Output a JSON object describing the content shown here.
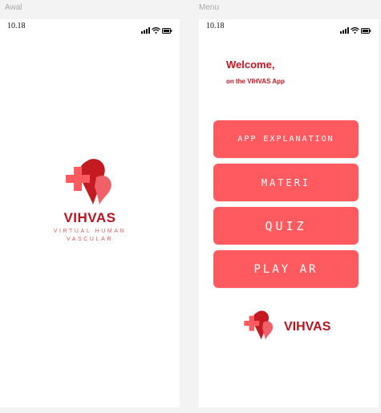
{
  "frames": {
    "splash_label": "Awal",
    "menu_label": "Menu"
  },
  "status_bar": {
    "time": "10.18",
    "icons": [
      "signal-icon",
      "wifi-icon",
      "battery-icon"
    ]
  },
  "splash": {
    "brand": "VIHVAS",
    "tagline_line1": "VIRTUAL HUMAN",
    "tagline_line2": "VASCULAR"
  },
  "menu": {
    "welcome": "Welcome,",
    "subtitle": "on the VIHVAS App",
    "buttons": [
      {
        "label": "APP EXPLANATION"
      },
      {
        "label": "MATERI"
      },
      {
        "label": "QUIZ"
      },
      {
        "label": "PLAY AR"
      }
    ],
    "footer_brand": "VIHVAS"
  },
  "colors": {
    "brand_red": "#b8151f",
    "button_red": "#ff5a5f",
    "heart_dark": "#c41a22",
    "heart_light": "#f06068"
  }
}
